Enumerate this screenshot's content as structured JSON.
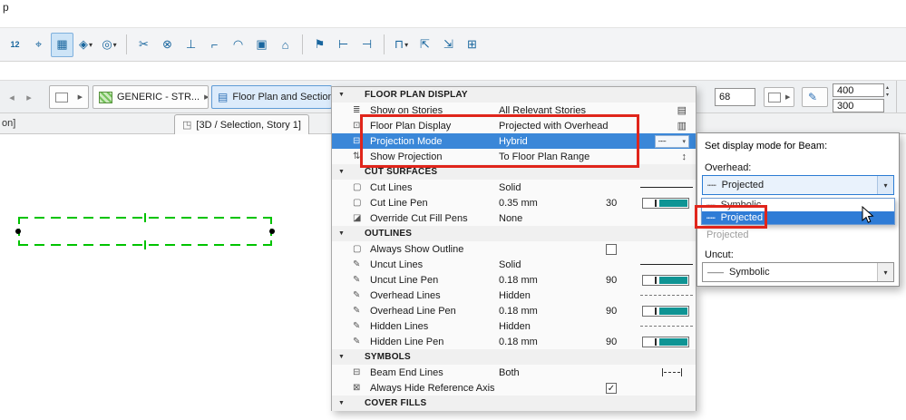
{
  "window": {
    "menu_partial": "p"
  },
  "icons": {
    "dropdown_arrow": "▾",
    "flyout_arrow": "▶",
    "back": "◂",
    "forward": "▸",
    "section_triangle": "▼",
    "check": "✓",
    "cube": "◳",
    "pencil": "✎",
    "dotted_line": "┅┅",
    "solid_line": "——",
    "spin_up": "▴",
    "spin_down": "▾"
  },
  "toolbar": {
    "items": [
      {
        "glyph": "12",
        "name": "dimension-style-icon"
      },
      {
        "glyph": "⌖",
        "name": "marquee-icon"
      },
      {
        "glyph": "▦",
        "name": "grid-snap-icon",
        "active": true
      },
      {
        "glyph": "◈",
        "name": "cutaway-view-icon",
        "dropdown": true
      },
      {
        "glyph": "◎",
        "name": "circle-tool-icon",
        "dropdown": true
      },
      {
        "sep": true
      },
      {
        "glyph": "✂",
        "name": "split-icon"
      },
      {
        "glyph": "⊗",
        "name": "intersect-icon"
      },
      {
        "glyph": "⊥",
        "name": "elevation-icon"
      },
      {
        "glyph": "⌐",
        "name": "corner-icon"
      },
      {
        "glyph": "◠",
        "name": "fillet-icon"
      },
      {
        "glyph": "▣",
        "name": "figure-tool-icon"
      },
      {
        "glyph": "⌂",
        "name": "home-story-icon"
      },
      {
        "sep": true
      },
      {
        "glyph": "⚑",
        "name": "flag-icon"
      },
      {
        "glyph": "⊢",
        "name": "exterior-dimension-icon"
      },
      {
        "glyph": "⊣",
        "name": "interior-dimension-icon"
      },
      {
        "sep": true
      },
      {
        "glyph": "⊓",
        "name": "measure-tool-icon",
        "dropdown": true
      },
      {
        "glyph": "⇱",
        "name": "pick-up-settings-icon"
      },
      {
        "glyph": "⇲",
        "name": "inject-settings-icon"
      },
      {
        "glyph": "⊞",
        "name": "grid-system-icon"
      }
    ]
  },
  "infobar": {
    "generic_label": "GENERIC - STR...",
    "panel_button_label": "Floor Plan and Section...",
    "field_value": "68",
    "width_value": "400",
    "height_value": "300"
  },
  "tabs": {
    "left_partial": "on]",
    "active_label": "[3D / Selection, Story 1]"
  },
  "panel": {
    "rows": [
      {
        "type": "header",
        "label": "FLOOR PLAN DISPLAY"
      },
      {
        "type": "row",
        "icon": "≣",
        "iconName": "show-on-stories-icon",
        "label": "Show on Stories",
        "value": "All Relevant Stories",
        "right": "icon",
        "rightGlyph": "▤",
        "rightName": "stories-settings-icon"
      },
      {
        "type": "row",
        "icon": "⊡",
        "iconName": "floor-plan-display-icon",
        "label": "Floor Plan Display",
        "value": "Projected with Overhead",
        "right": "icon",
        "rightGlyph": "▥",
        "rightName": "display-settings-icon"
      },
      {
        "type": "row",
        "icon": "⊟",
        "iconName": "projection-mode-icon",
        "label": "Projection Mode",
        "value": "Hybrid",
        "selected": true,
        "right": "combo"
      },
      {
        "type": "row",
        "icon": "⇅",
        "iconName": "show-projection-icon",
        "label": "Show Projection",
        "value": "To Floor Plan Range",
        "right": "icon",
        "rightGlyph": "↕",
        "rightName": "projection-range-icon"
      },
      {
        "type": "header",
        "label": "CUT SURFACES"
      },
      {
        "type": "row",
        "icon": "▢",
        "iconName": "cut-lines-icon",
        "label": "Cut Lines",
        "value": "Solid",
        "right": "line-solid"
      },
      {
        "type": "row",
        "icon": "▢",
        "iconName": "cut-line-pen-icon",
        "label": "Cut Line Pen",
        "value": "0.35 mm",
        "extra": "30",
        "right": "penbar"
      },
      {
        "type": "row",
        "icon": "◪",
        "iconName": "override-cut-fill-pens-icon",
        "label": "Override Cut Fill Pens",
        "value": "None",
        "right": "none"
      },
      {
        "type": "header",
        "label": "OUTLINES"
      },
      {
        "type": "row",
        "icon": "▢",
        "iconName": "always-show-outline-icon",
        "label": "Always Show Outline",
        "value": "",
        "right": "checkbox",
        "checked": false
      },
      {
        "type": "row",
        "icon": "✎",
        "iconName": "uncut-lines-icon",
        "label": "Uncut Lines",
        "value": "Solid",
        "right": "line-solid"
      },
      {
        "type": "row",
        "icon": "✎",
        "iconName": "uncut-line-pen-icon",
        "label": "Uncut Line Pen",
        "value": "0.18 mm",
        "extra": "90",
        "right": "penbar"
      },
      {
        "type": "row",
        "icon": "✎",
        "iconName": "overhead-lines-icon",
        "label": "Overhead Lines",
        "value": "Hidden",
        "right": "line-dashed"
      },
      {
        "type": "row",
        "icon": "✎",
        "iconName": "overhead-line-pen-icon",
        "label": "Overhead Line Pen",
        "value": "0.18 mm",
        "extra": "90",
        "right": "penbar"
      },
      {
        "type": "row",
        "icon": "✎",
        "iconName": "hidden-lines-icon",
        "label": "Hidden Lines",
        "value": "Hidden",
        "right": "line-dashed"
      },
      {
        "type": "row",
        "icon": "✎",
        "iconName": "hidden-line-pen-icon",
        "label": "Hidden Line Pen",
        "value": "0.18 mm",
        "extra": "90",
        "right": "penbar"
      },
      {
        "type": "header",
        "label": "SYMBOLS"
      },
      {
        "type": "row",
        "icon": "⊟",
        "iconName": "beam-end-lines-icon",
        "label": "Beam End Lines",
        "value": "Both",
        "right": "endcaps"
      },
      {
        "type": "row",
        "icon": "⊠",
        "iconName": "hide-reference-axis-icon",
        "label": "Always Hide Reference Axis",
        "value": "",
        "right": "checkbox",
        "checked": true
      },
      {
        "type": "header",
        "label": "COVER FILLS"
      }
    ]
  },
  "popup": {
    "title": "Set display mode for Beam:",
    "overhead_label": "Overhead:",
    "overhead_value": "Projected",
    "dropdown_items": [
      {
        "label": "Symbolic",
        "selected": false
      },
      {
        "label": "Projected",
        "selected": true
      }
    ],
    "dimmed_label": "Projected",
    "uncut_label": "Uncut:",
    "uncut_value": "Symbolic"
  },
  "colors": {
    "selection_blue": "#3a87d8",
    "highlight_red": "#e0251b",
    "beam_green": "#00c300",
    "pen_teal": "#0f9494"
  }
}
